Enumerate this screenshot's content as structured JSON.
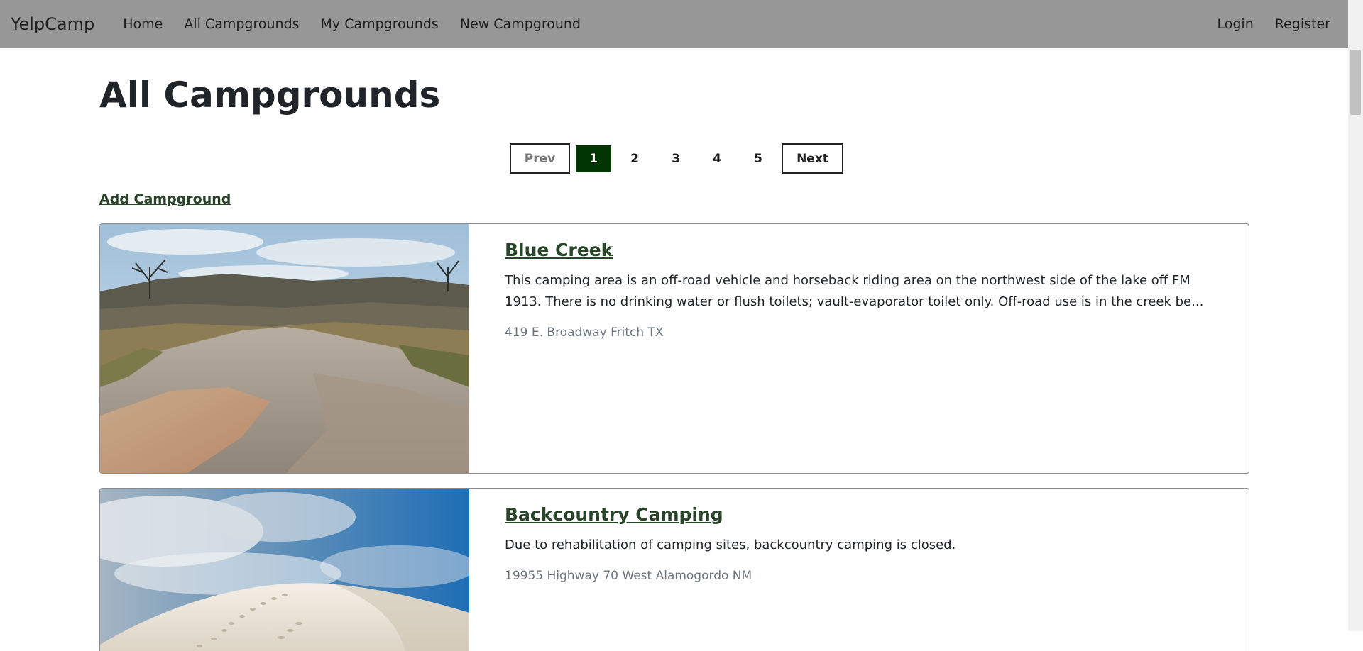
{
  "navbar": {
    "brand": "YelpCamp",
    "links": [
      {
        "label": "Home"
      },
      {
        "label": "All Campgrounds"
      },
      {
        "label": "My Campgrounds"
      },
      {
        "label": "New Campground"
      }
    ],
    "right_links": [
      {
        "label": "Login"
      },
      {
        "label": "Register"
      }
    ]
  },
  "page": {
    "title": "All Campgrounds",
    "add_link": "Add Campground"
  },
  "pagination": {
    "prev": "Prev",
    "next": "Next",
    "pages": [
      "1",
      "2",
      "3",
      "4",
      "5"
    ],
    "active_page": "1"
  },
  "campgrounds": [
    {
      "title": "Blue Creek",
      "description": "This camping area is an off-road vehicle and horseback riding area on the northwest side of the lake off FM 1913. There is no drinking water or flush toilets; vault-evaporator toilet only. Off-road use is in the creek be...",
      "location": "419 E. Broadway Fritch TX",
      "image": "creek-landscape"
    },
    {
      "title": "Backcountry Camping",
      "description": "Due to rehabilitation of camping sites, backcountry camping is closed.",
      "location": "19955 Highway 70 West Alamogordo NM",
      "image": "white-sand-dune"
    }
  ],
  "colors": {
    "navbar_bg": "#979797",
    "accent_dark_green": "#003400",
    "link_green": "#294529",
    "muted_text": "#6c757d"
  }
}
